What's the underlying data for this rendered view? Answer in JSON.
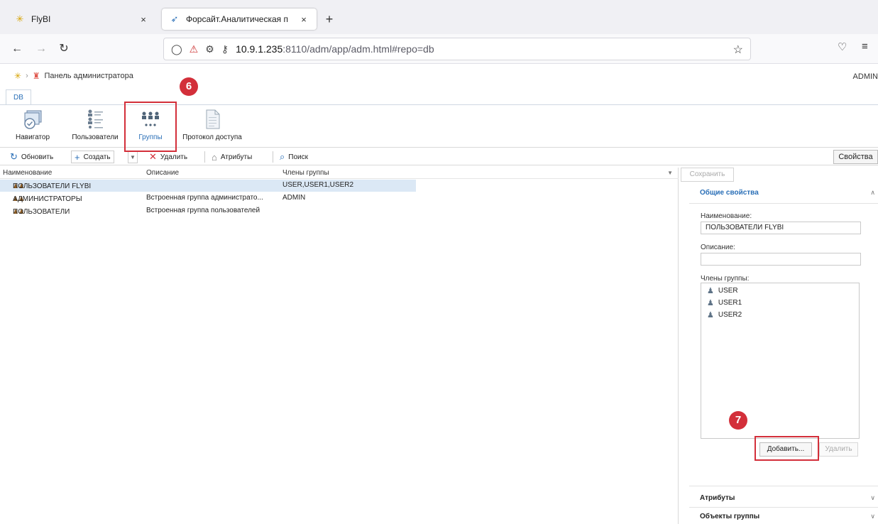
{
  "browser": {
    "tabs": [
      {
        "title": "FlyBI",
        "close": "×"
      },
      {
        "title": "Форсайт.Аналитическая п",
        "close": "×"
      }
    ],
    "new_tab": "+",
    "url_host": "10.9.1.235",
    "url_rest": ":8110/adm/app/adm.html#repo=db"
  },
  "app": {
    "breadcrumb": "Панель администратора",
    "user": "ADMIN",
    "repo_tab": "DB"
  },
  "ribbon": {
    "navigator": "Навигатор",
    "users": "Пользователи",
    "groups": "Группы",
    "access_log": "Протокол доступа"
  },
  "toolbar": {
    "refresh": "Обновить",
    "create": "Создать",
    "delete": "Удалить",
    "attributes": "Атрибуты",
    "search": "Поиск",
    "properties": "Свойства"
  },
  "grid": {
    "columns": [
      "Наименование",
      "Описание",
      "Члены группы"
    ],
    "rows": [
      {
        "name": "ПОЛЬЗОВАТЕЛИ FLYBI",
        "description": "",
        "members": "USER,USER1,USER2"
      },
      {
        "name": "АДМИНИСТРАТОРЫ",
        "description": "Встроенная группа администрато...",
        "members": "ADMIN"
      },
      {
        "name": "ПОЛЬЗОВАТЕЛИ",
        "description": "Встроенная группа пользователей",
        "members": ""
      }
    ]
  },
  "panel": {
    "save": "Сохранить",
    "general_section": "Общие свойства",
    "name_label": "Наименование:",
    "name_value": "ПОЛЬЗОВАТЕЛИ FLYBI",
    "description_label": "Описание:",
    "description_value": "",
    "members_label": "Члены группы:",
    "members": [
      "USER",
      "USER1",
      "USER2"
    ],
    "add": "Добавить...",
    "remove": "Удалить",
    "attributes_section": "Атрибуты",
    "objects_section": "Объекты группы"
  },
  "annotations": {
    "step_groups": "6",
    "step_add": "7"
  },
  "colors": {
    "accent": "#2a6fb7",
    "highlight": "#d32f3a",
    "selection": "#dbe8f5"
  }
}
